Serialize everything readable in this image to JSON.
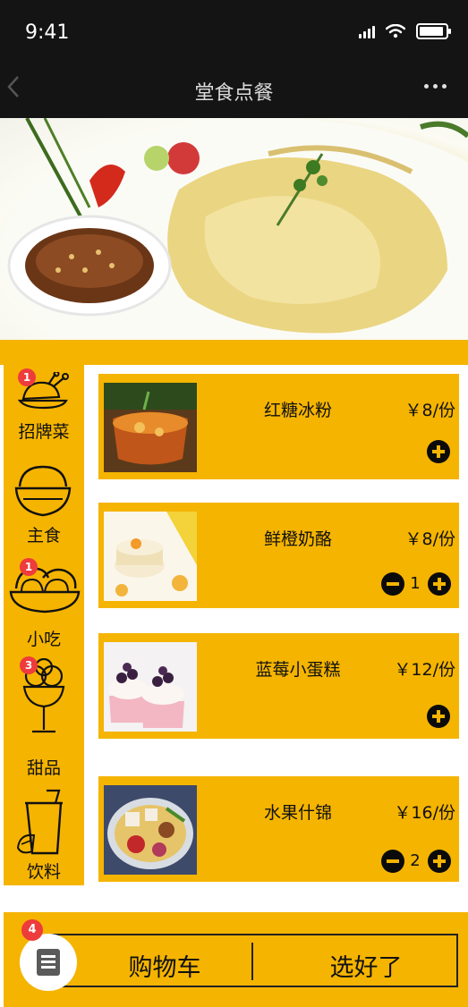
{
  "status_bar": {
    "time": "9:41"
  },
  "nav": {
    "title": "堂食点餐"
  },
  "categories": [
    {
      "label": "招牌菜",
      "badge": "1",
      "icon": "roast-chicken-icon"
    },
    {
      "label": "主食",
      "badge": "",
      "icon": "rice-bowl-icon"
    },
    {
      "label": "小吃",
      "badge": "1",
      "icon": "buns-icon"
    },
    {
      "label": "甜品",
      "badge": "3",
      "icon": "ice-cream-icon"
    },
    {
      "label": "饮料",
      "badge": "",
      "icon": "drink-cup-icon"
    }
  ],
  "items": [
    {
      "name": "红糖冰粉",
      "price": "￥8/份",
      "quantity": ""
    },
    {
      "name": "鲜橙奶酪",
      "price": "￥8/份",
      "quantity": "1"
    },
    {
      "name": "蓝莓小蛋糕",
      "price": "￥12/份",
      "quantity": ""
    },
    {
      "name": "水果什锦",
      "price": "￥16/份",
      "quantity": "2"
    }
  ],
  "cart": {
    "badge": "4",
    "label": "购物车",
    "checkout_label": "选好了",
    "icon": "list-icon"
  },
  "colors": {
    "accent": "#f5b400",
    "dark": "#141414",
    "badge": "#ee3b3b"
  }
}
